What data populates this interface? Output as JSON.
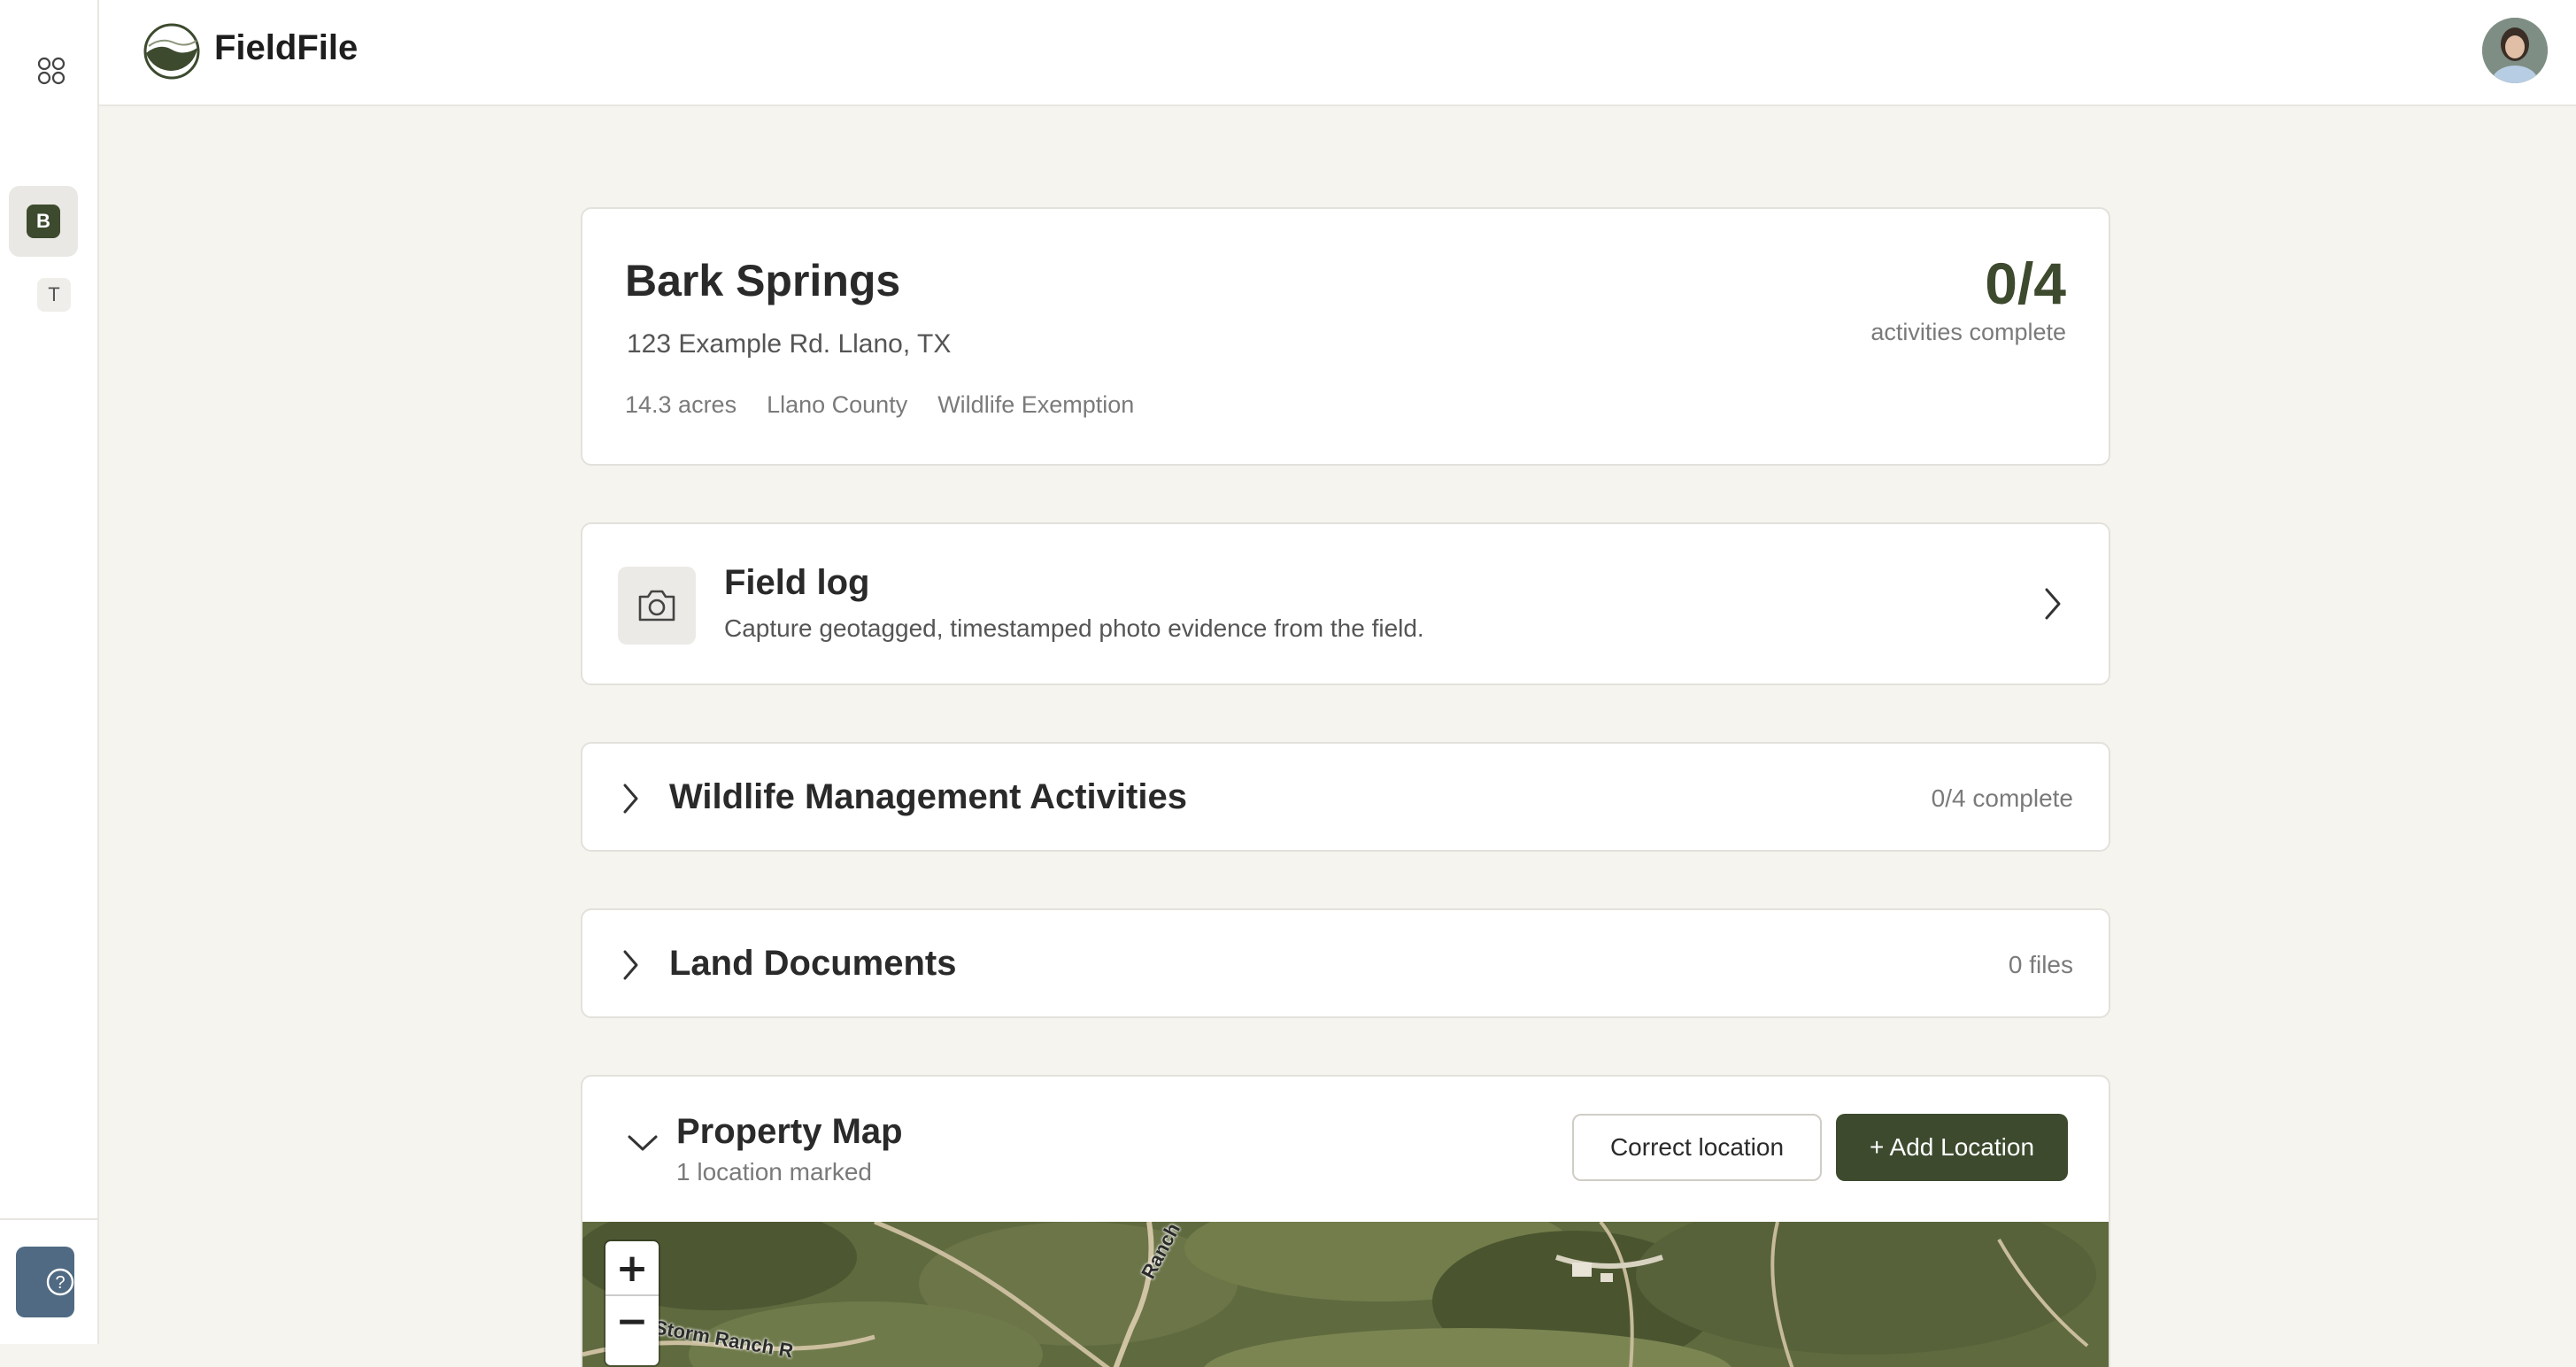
{
  "app": {
    "brand": "FieldFile"
  },
  "rail": {
    "items": [
      {
        "badge": "B",
        "active": true
      },
      {
        "badge": "T",
        "active": false
      }
    ]
  },
  "property": {
    "name": "Bark Springs",
    "address": "123 Example Rd. Llano, TX",
    "acres": "14.3 acres",
    "county": "Llano County",
    "exemption": "Wildlife Exemption",
    "progress": "0/4",
    "progress_label": "activities complete"
  },
  "field_log": {
    "title": "Field log",
    "subtitle": "Capture geotagged, timestamped photo evidence from the field."
  },
  "wildlife": {
    "title": "Wildlife Management Activities",
    "status": "0/4 complete"
  },
  "documents": {
    "title": "Land Documents",
    "status": "0 files"
  },
  "map": {
    "title": "Property Map",
    "subtitle": "1 location marked",
    "correct_label": "Correct location",
    "add_label": "+ Add Location",
    "zoom_in": "+",
    "zoom_out": "−",
    "road_labels": [
      "Ranch",
      "Storm Ranch R"
    ]
  },
  "colors": {
    "accent": "#3d4a2e",
    "background": "#f6f4ef",
    "help_button": "#4f6a82"
  }
}
